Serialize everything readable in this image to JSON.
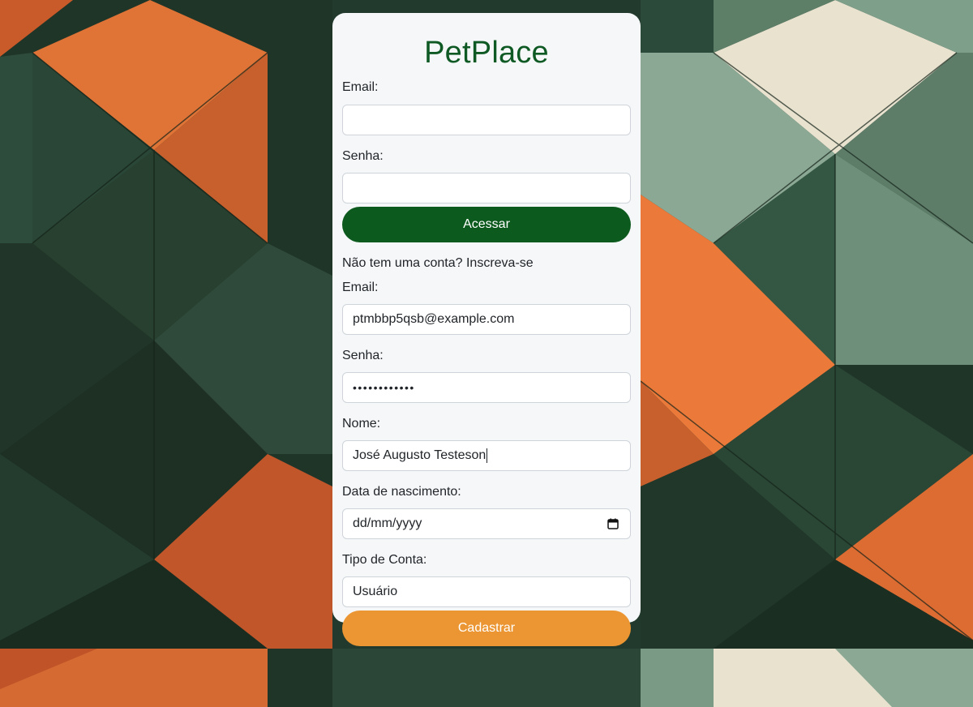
{
  "app": {
    "title": "PetPlace"
  },
  "login": {
    "email_label": "Email:",
    "email_value": "",
    "password_label": "Senha:",
    "password_value": "",
    "submit_label": "Acessar"
  },
  "signup": {
    "prompt": "Não tem uma conta? Inscreva-se",
    "email_label": "Email:",
    "email_value": "ptmbbp5qsb@example.com",
    "password_label": "Senha:",
    "password_masked": "••••••••••••",
    "name_label": "Nome:",
    "name_value": "José Augusto Testeson",
    "birthdate_label": "Data de nascimento:",
    "birthdate_placeholder": "dd/mm/yyyy",
    "account_type_label": "Tipo de Conta:",
    "account_type_value": "Usuário",
    "submit_label": "Cadastrar"
  },
  "icons": {
    "birthdate": "calendar-icon"
  },
  "colors": {
    "brand": "#0f5a24",
    "primary_button": "#0d5a1f",
    "accent_button": "#eb9632",
    "card_background": "#f6f7f9"
  }
}
